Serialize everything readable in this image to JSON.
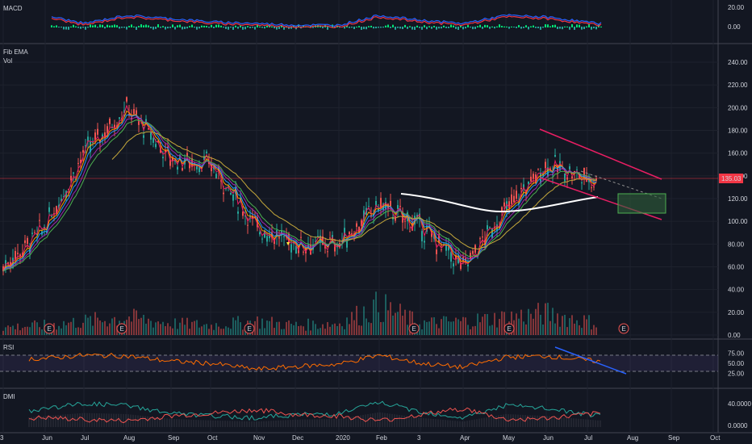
{
  "panes": {
    "macd": {
      "title": "MACD",
      "ticks": [
        "20.00",
        "0.00"
      ]
    },
    "price": {
      "title": "Fib EMA",
      "subtitle": "Vol",
      "ticks": [
        "240.00",
        "220.00",
        "200.00",
        "180.00",
        "160.00",
        "140.00",
        "120.00",
        "100.00",
        "80.00",
        "60.00",
        "40.00",
        "20.00",
        "0.00"
      ],
      "last_price": "135.03",
      "earnings_label": "E"
    },
    "rsi": {
      "title": "RSI",
      "ticks": [
        "75.00",
        "50.00",
        "25.00"
      ]
    },
    "dmi": {
      "title": "DMI",
      "ticks": [
        "40.0000",
        "0.0000"
      ]
    }
  },
  "time_axis": [
    "3",
    "Jun",
    "Jul",
    "Aug",
    "Sep",
    "Oct",
    "Nov",
    "Dec",
    "2020",
    "Feb",
    "3",
    "Apr",
    "May",
    "Jun",
    "Jul",
    "Aug",
    "Sep",
    "Oct"
  ],
  "colors": {
    "background": "#131722",
    "up": "#26a69a",
    "down": "#ef5350",
    "macd_line": "#2962ff",
    "signal_line": "#f23645",
    "hist_up": "#00e676",
    "rsi_line": "#ff6d00",
    "rsi_band": "#7e57c2",
    "dmi_plus": "#26a69a",
    "dmi_minus": "#ef5350",
    "channel": "#e91e63",
    "ema_200": "#ffffff",
    "ema_slow": "#c6a93b"
  },
  "chart_data": [
    {
      "type": "line",
      "pane": "price",
      "title": "Fib EMA",
      "ylim": [
        0,
        245
      ],
      "x": [
        "3",
        "Jun",
        "Jul",
        "Aug",
        "Sep",
        "Oct",
        "Nov",
        "Dec",
        "2020",
        "Feb",
        "3",
        "Apr",
        "May",
        "Jun",
        "Jul"
      ],
      "series": [
        {
          "name": "",
          "values": [
            60,
            95,
            160,
            200,
            155,
            150,
            95,
            80,
            80,
            115,
            95,
            60,
            110,
            150,
            135
          ]
        }
      ],
      "last_value": 135.03
    },
    {
      "type": "bar",
      "pane": "volume",
      "values": [
        8,
        10,
        14,
        18,
        12,
        10,
        14,
        10,
        12,
        30,
        12,
        14,
        18,
        22,
        12
      ]
    },
    {
      "type": "line",
      "pane": "rsi",
      "title": "RSI",
      "ylim": [
        0,
        100
      ],
      "bands": [
        70,
        30
      ],
      "series": [
        {
          "name": "",
          "values": [
            60,
            62,
            70,
            68,
            55,
            50,
            35,
            42,
            48,
            70,
            50,
            40,
            65,
            68,
            55
          ]
        }
      ]
    },
    {
      "type": "line",
      "pane": "dmi",
      "title": "DMI",
      "ylim": [
        0,
        55
      ],
      "series": [
        {
          "name": "",
          "values": [
            20,
            30,
            38,
            35,
            22,
            18,
            15,
            20,
            22,
            40,
            25,
            15,
            35,
            30,
            18
          ]
        },
        {
          "name": "",
          "values": [
            12,
            15,
            12,
            10,
            18,
            22,
            28,
            20,
            18,
            10,
            20,
            30,
            12,
            14,
            22
          ]
        }
      ]
    }
  ]
}
